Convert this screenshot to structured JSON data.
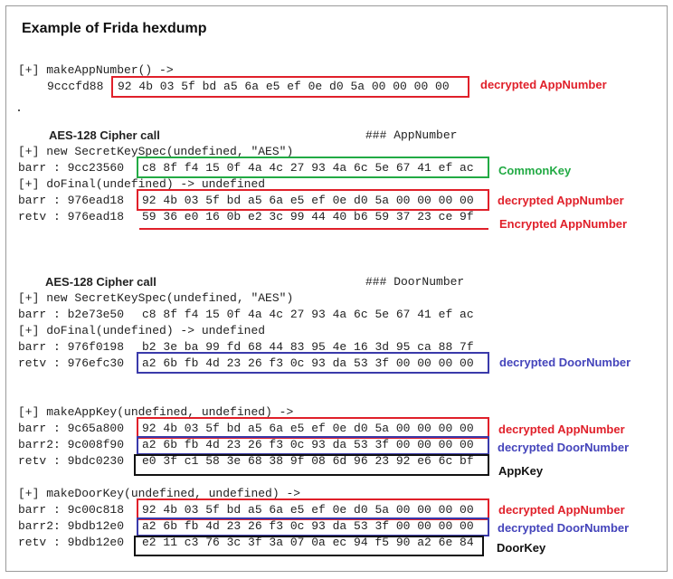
{
  "title": "Example of Frida hexdump",
  "section1": {
    "call": "[+] makeAppNumber() ->",
    "addr": "9cccfd88",
    "hex": "92 4b 03 5f bd a5 6a e5 ef 0e d0 5a 00 00 00 00",
    "note": "decrypted AppNumber"
  },
  "section2": {
    "heading": "AES-128 Cipher call",
    "comment": "### AppNumber",
    "line1": "[+] new SecretKeySpec(undefined, \"AES\")",
    "barr1_label": "barr : 9cc23560",
    "barr1_hex": "c8 8f f4 15 0f 4a 4c 27 93 4a 6c 5e 67 41 ef ac",
    "barr1_note": "CommonKey",
    "line2": "[+] doFinal(undefined) -> undefined",
    "barr2_label": "barr : 976ead18",
    "barr2_hex": "92 4b 03 5f bd a5 6a e5 ef 0e d0 5a 00 00 00 00",
    "barr2_note": "decrypted AppNumber",
    "retv_label": "retv : 976ead18",
    "retv_hex": "59 36 e0 16 0b e2 3c 99 44 40 b6 59 37 23 ce 9f",
    "retv_note": "Encrypted AppNumber"
  },
  "section3": {
    "heading": "AES-128 Cipher call",
    "comment": "### DoorNumber",
    "line1": "[+] new SecretKeySpec(undefined, \"AES\")",
    "barr1_label": "barr : b2e73e50",
    "barr1_hex": "c8 8f f4 15 0f 4a 4c 27 93 4a 6c 5e 67 41 ef ac",
    "line2": "[+] doFinal(undefined) -> undefined",
    "barr2_label": "barr : 976f0198",
    "barr2_hex": "b2 3e ba 99 fd 68 44 83 95 4e 16 3d 95 ca 88 7f",
    "retv_label": "retv : 976efc30",
    "retv_hex": "a2 6b fb 4d 23 26 f3 0c 93 da 53 3f 00 00 00 00",
    "retv_note": "decrypted DoorNumber"
  },
  "section4": {
    "call": "[+] makeAppKey(undefined, undefined) ->",
    "barr_label": "barr : 9c65a800",
    "barr_hex": "92 4b 03 5f bd a5 6a e5 ef 0e d0 5a 00 00 00 00",
    "barr_note": "decrypted AppNumber",
    "barr2_label": "barr2: 9c008f90",
    "barr2_hex": "a2 6b fb 4d 23 26 f3 0c 93 da 53 3f 00 00 00 00",
    "barr2_note": "decrypted DoorNumber",
    "retv_label": "retv : 9bdc0230",
    "retv_hex": "e0 3f c1 58 3e 68 38 9f 08 6d 96 23 92 e6 6c bf",
    "retv_note": "AppKey"
  },
  "section5": {
    "call": "[+] makeDoorKey(undefined, undefined) ->",
    "barr_label": "barr : 9c00c818",
    "barr_hex": "92 4b 03 5f bd a5 6a e5 ef 0e d0 5a 00 00 00 00",
    "barr_note": "decrypted AppNumber",
    "barr2_label": "barr2: 9bdb12e0",
    "barr2_hex": "a2 6b fb 4d 23 26 f3 0c 93 da 53 3f 00 00 00 00",
    "barr2_note": "decrypted DoorNumber",
    "retv_label": "retv : 9bdb12e0",
    "retv_hex": "e2 11 c3 76 3c 3f 3a 07 0a ec 94 f5 90 a2 6e 84",
    "retv_note": "DoorKey"
  },
  "colors": {
    "red": "#e0202a",
    "blue": "#3a3aaa",
    "green": "#22aa44",
    "black": "#111111"
  }
}
